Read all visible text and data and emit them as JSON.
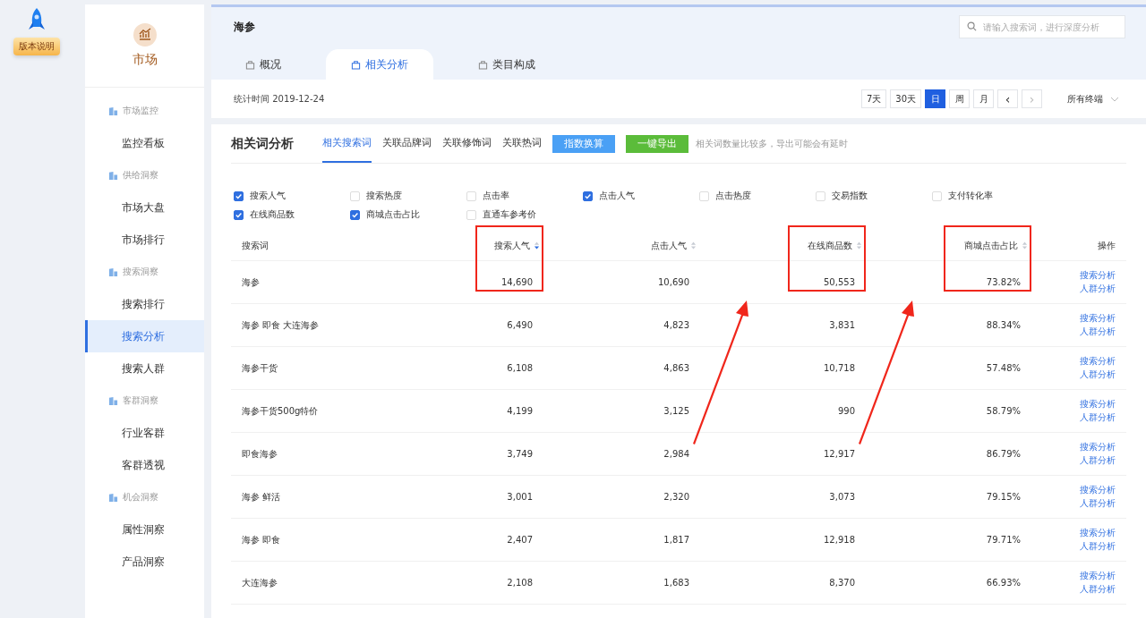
{
  "badge": {
    "label": "版本说明"
  },
  "sidebar": {
    "title": "市场",
    "groups": [
      {
        "label": "市场监控",
        "items": [
          {
            "label": "监控看板",
            "selected": false
          }
        ]
      },
      {
        "label": "供给洞察",
        "items": [
          {
            "label": "市场大盘",
            "selected": false
          },
          {
            "label": "市场排行",
            "selected": false
          }
        ]
      },
      {
        "label": "搜索洞察",
        "items": [
          {
            "label": "搜索排行",
            "selected": false
          },
          {
            "label": "搜索分析",
            "selected": true
          },
          {
            "label": "搜索人群",
            "selected": false
          }
        ]
      },
      {
        "label": "客群洞察",
        "items": [
          {
            "label": "行业客群",
            "selected": false
          },
          {
            "label": "客群透视",
            "selected": false
          }
        ]
      },
      {
        "label": "机会洞察",
        "items": [
          {
            "label": "属性洞察",
            "selected": false
          },
          {
            "label": "产品洞察",
            "selected": false
          }
        ]
      }
    ]
  },
  "header": {
    "keyword": "海参",
    "search": {
      "placeholder": "请输入搜索词，进行深度分析"
    },
    "tabs": [
      {
        "label": "概况",
        "selected": false
      },
      {
        "label": "相关分析",
        "selected": true
      },
      {
        "label": "类目构成",
        "selected": false
      }
    ]
  },
  "date_bar": {
    "stat_time": "统计时间 2019-12-24",
    "periods": [
      {
        "label": "7天",
        "selected": false
      },
      {
        "label": "30天",
        "selected": false
      },
      {
        "label": "日",
        "selected": true
      },
      {
        "label": "周",
        "selected": false
      },
      {
        "label": "月",
        "selected": false
      }
    ],
    "prev": "‹",
    "next": "›",
    "terminal": "所有终端"
  },
  "panel": {
    "title": "相关词分析",
    "tabs": [
      {
        "label": "相关搜索词",
        "selected": true
      },
      {
        "label": "关联品牌词",
        "selected": false
      },
      {
        "label": "关联修饰词",
        "selected": false
      },
      {
        "label": "关联热词",
        "selected": false
      }
    ],
    "buttons": [
      {
        "label": "指数换算",
        "kind": "primary"
      },
      {
        "label": "一键导出",
        "kind": "success"
      }
    ],
    "hint": "相关词数量比较多，导出可能会有延时",
    "metrics": [
      {
        "label": "搜索人气",
        "checked": true
      },
      {
        "label": "搜索热度",
        "checked": false
      },
      {
        "label": "点击率",
        "checked": false
      },
      {
        "label": "点击人气",
        "checked": true
      },
      {
        "label": "点击热度",
        "checked": false
      },
      {
        "label": "交易指数",
        "checked": false
      },
      {
        "label": "支付转化率",
        "checked": false
      },
      {
        "label": "在线商品数",
        "checked": true
      },
      {
        "label": "商城点击占比",
        "checked": true
      },
      {
        "label": "直通车参考价",
        "checked": false
      }
    ],
    "table": {
      "columns": [
        {
          "label": "搜索词",
          "kind": "text",
          "sortable": false,
          "highlighted": false,
          "arrow": false
        },
        {
          "label": "搜索人气",
          "kind": "number",
          "sortable": true,
          "sorted_desc": true,
          "highlighted": true,
          "arrow": false
        },
        {
          "label": "点击人气",
          "kind": "number",
          "sortable": true,
          "sorted_desc": false,
          "highlighted": false,
          "arrow": false
        },
        {
          "label": "在线商品数",
          "kind": "number",
          "sortable": true,
          "sorted_desc": false,
          "highlighted": true,
          "arrow": true
        },
        {
          "label": "商城点击占比",
          "kind": "number",
          "sortable": true,
          "sorted_desc": false,
          "highlighted": true,
          "arrow": true
        },
        {
          "label": "操作",
          "kind": "actions",
          "sortable": false,
          "highlighted": false,
          "arrow": false
        }
      ],
      "rows": [
        {
          "cells": [
            "海参",
            "14,690",
            "10,690",
            "50,553",
            "73.82%"
          ],
          "actions": [
            "搜索分析",
            "人群分析"
          ]
        },
        {
          "cells": [
            "海参 即食 大连海参",
            "6,490",
            "4,823",
            "3,831",
            "88.34%"
          ],
          "actions": [
            "搜索分析",
            "人群分析"
          ]
        },
        {
          "cells": [
            "海参干货",
            "6,108",
            "4,863",
            "10,718",
            "57.48%"
          ],
          "actions": [
            "搜索分析",
            "人群分析"
          ]
        },
        {
          "cells": [
            "海参干货500g特价",
            "4,199",
            "3,125",
            "990",
            "58.79%"
          ],
          "actions": [
            "搜索分析",
            "人群分析"
          ]
        },
        {
          "cells": [
            "即食海参",
            "3,749",
            "2,984",
            "12,917",
            "86.79%"
          ],
          "actions": [
            "搜索分析",
            "人群分析"
          ]
        },
        {
          "cells": [
            "海参 鲜活",
            "3,001",
            "2,320",
            "3,073",
            "79.15%"
          ],
          "actions": [
            "搜索分析",
            "人群分析"
          ]
        },
        {
          "cells": [
            "海参 即食",
            "2,407",
            "1,817",
            "12,918",
            "79.71%"
          ],
          "actions": [
            "搜索分析",
            "人群分析"
          ]
        },
        {
          "cells": [
            "大连海参",
            "2,108",
            "1,683",
            "8,370",
            "66.93%"
          ],
          "actions": [
            "搜索分析",
            "人群分析"
          ]
        }
      ]
    }
  }
}
